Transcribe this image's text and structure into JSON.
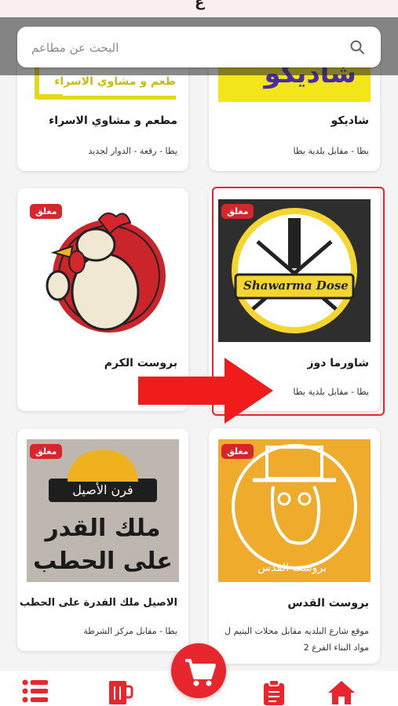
{
  "top": {
    "partial_char": "ع"
  },
  "search": {
    "placeholder": "البحث عن مطاعم"
  },
  "restaurants": [
    {
      "name": "شاديكو",
      "address": "يطا - مقابل بلدية يطا",
      "logo_text": "شاديكو",
      "status": ""
    },
    {
      "name": "مطعم و مشاوي الاسراء",
      "address": "يطا - رقعة - الدوار لجديد",
      "logo_text": "طعم و مشاوي الاسراء",
      "status": ""
    },
    {
      "name": "شاورما دوز",
      "address": "يطا - مقابل بلدية يطا",
      "logo_text": "Shawarma Dose",
      "status": "مغلق"
    },
    {
      "name": "بروست الكرم",
      "address": "",
      "logo_text": "",
      "status": "مغلق"
    },
    {
      "name": "بروست القدس",
      "address": "موقع شارع البلديه مقابل محلات اليتيم ل مواد البناء الفرع 2",
      "logo_text": "بروست القدس",
      "status": "مغلق"
    },
    {
      "name": "الاصيل ملك القدرة على الحطب",
      "address": "يطا - مقابل مركز الشرطة",
      "logo_text": "فرن الأصيل",
      "logo_text_2": "ملك القدر",
      "logo_text_3": "على الحطب",
      "status": "مغلق"
    }
  ],
  "nav": {
    "items": [
      "home",
      "orders",
      "cart",
      "drinks",
      "menu"
    ]
  },
  "colors": {
    "accent": "#e8262d",
    "yellow": "#f2e51a",
    "orange": "#eeab2c"
  }
}
